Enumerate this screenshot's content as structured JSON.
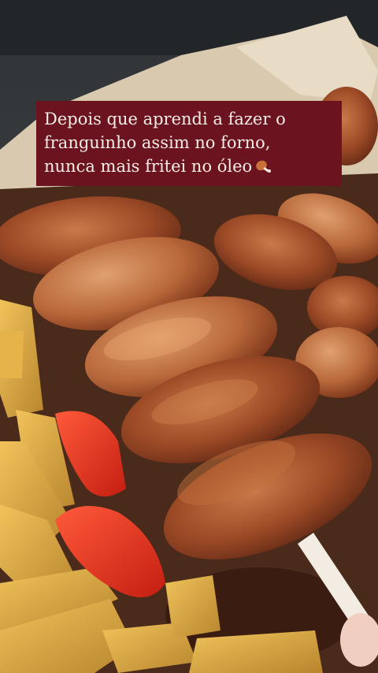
{
  "caption": {
    "lines": [
      "Depois que aprendi a fazer o",
      "franguinho assim no forno,",
      "nunca mais fritei no óleo"
    ],
    "emoji": "poultry-leg-icon"
  },
  "colors": {
    "caption_background": "#6b1420",
    "caption_text": "#f5ece6"
  }
}
